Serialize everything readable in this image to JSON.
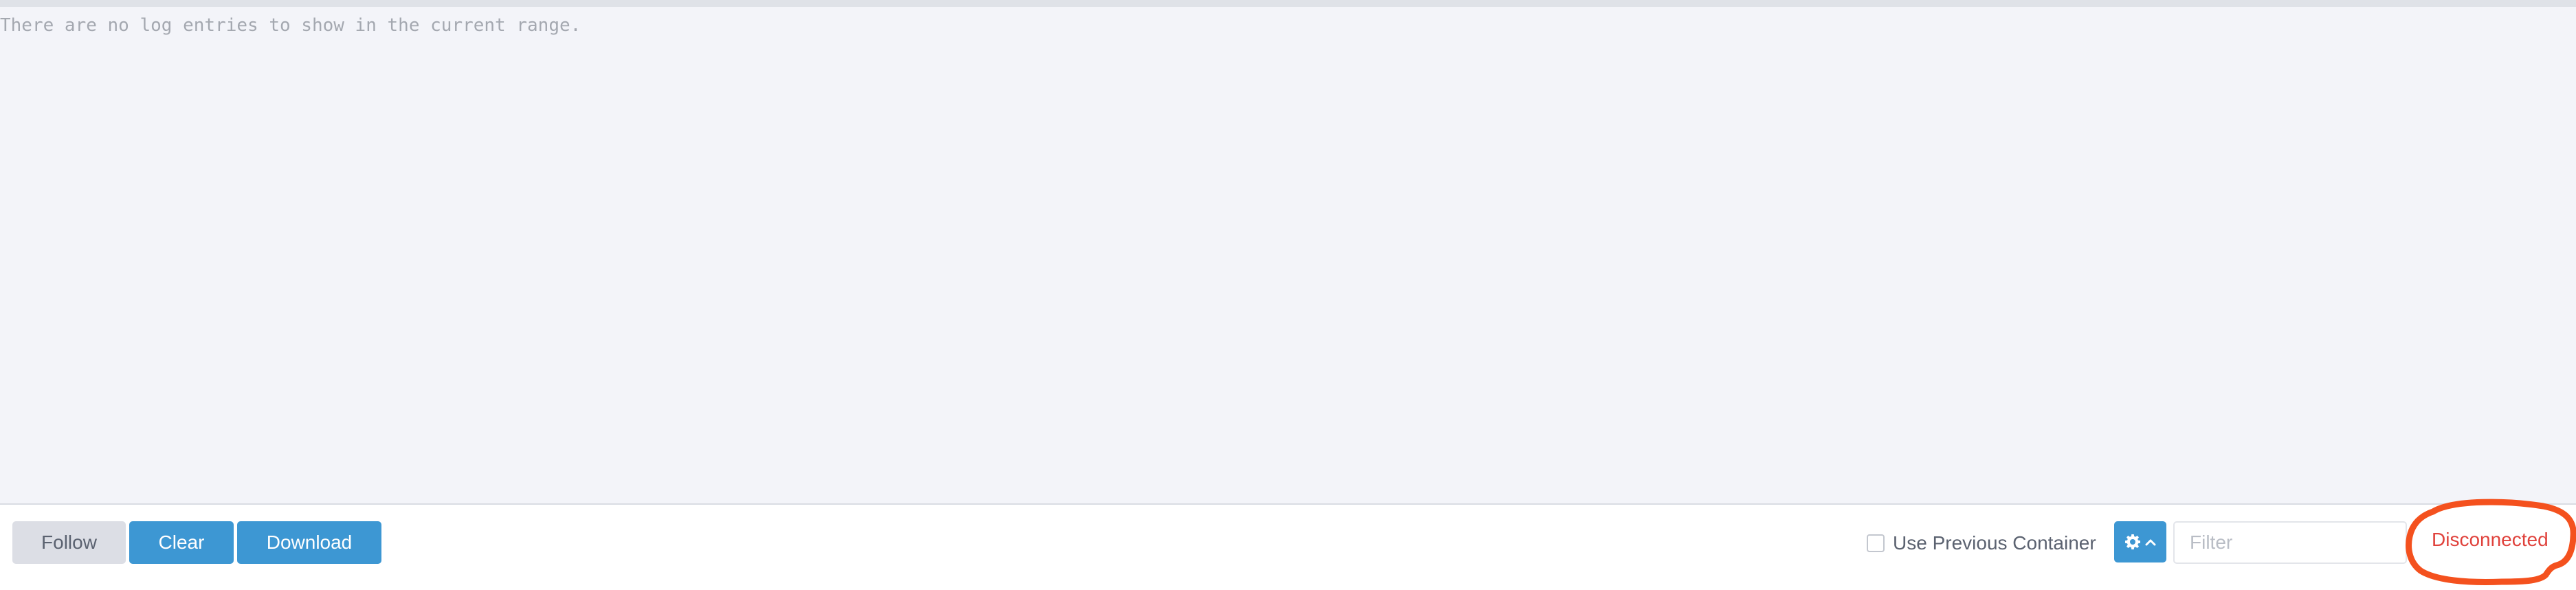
{
  "log_panel": {
    "empty_message": "There are no log entries to show in the current range."
  },
  "toolbar": {
    "follow_label": "Follow",
    "clear_label": "Clear",
    "download_label": "Download",
    "use_previous_container_label": "Use Previous Container",
    "use_previous_container_checked": false,
    "settings_icon": "gear-icon",
    "settings_caret_icon": "chevron-up-icon",
    "filter_placeholder": "Filter",
    "filter_value": "",
    "connection_status": "Disconnected"
  },
  "colors": {
    "accent": "#3d97d3",
    "status_error": "#e0423c",
    "annotation": "#f4511e",
    "log_background": "#f3f4f9"
  }
}
